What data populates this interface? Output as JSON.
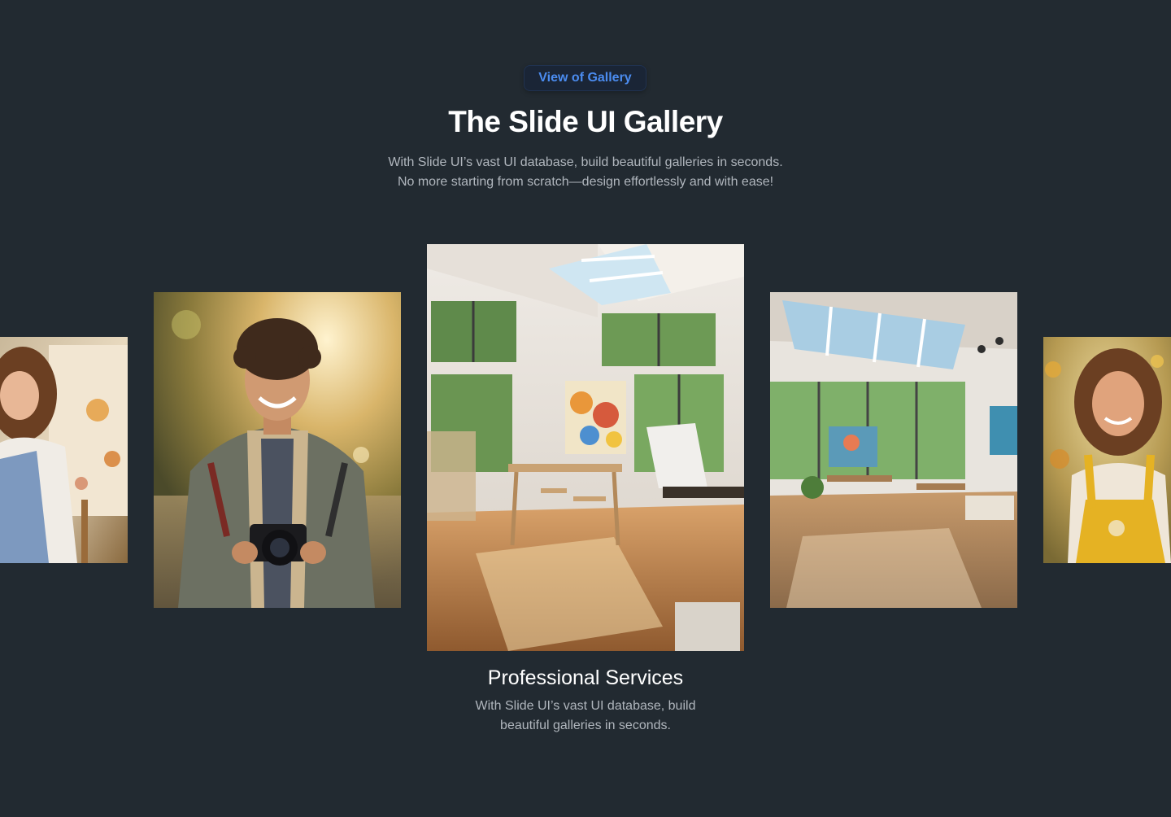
{
  "header": {
    "badge_label": "View of Gallery",
    "title": "The Slide UI Gallery",
    "subtitle_line1": "With Slide UI’s vast UI database, build beautiful galleries in seconds.",
    "subtitle_line2": "No more starting from scratch—design effortlessly and with ease!"
  },
  "gallery": {
    "slides": [
      {
        "image": "woman-painter-with-canvas-photo",
        "active": false
      },
      {
        "image": "smiling-man-with-camera-photo",
        "active": false
      },
      {
        "image": "sunlit-art-studio-interior-photo",
        "active": true
      },
      {
        "image": "bright-art-studio-skylight-photo",
        "active": false
      },
      {
        "image": "smiling-woman-yellow-overalls-photo",
        "active": false
      }
    ],
    "active_caption": {
      "title": "Professional Services",
      "text_line1": "With Slide UI’s vast UI database, build",
      "text_line2": "beautiful galleries in seconds."
    }
  },
  "colors": {
    "background": "#222a31",
    "badge_text": "#4b8cf0",
    "badge_bg": "#1a2536",
    "muted_text": "#b0b6bd"
  }
}
